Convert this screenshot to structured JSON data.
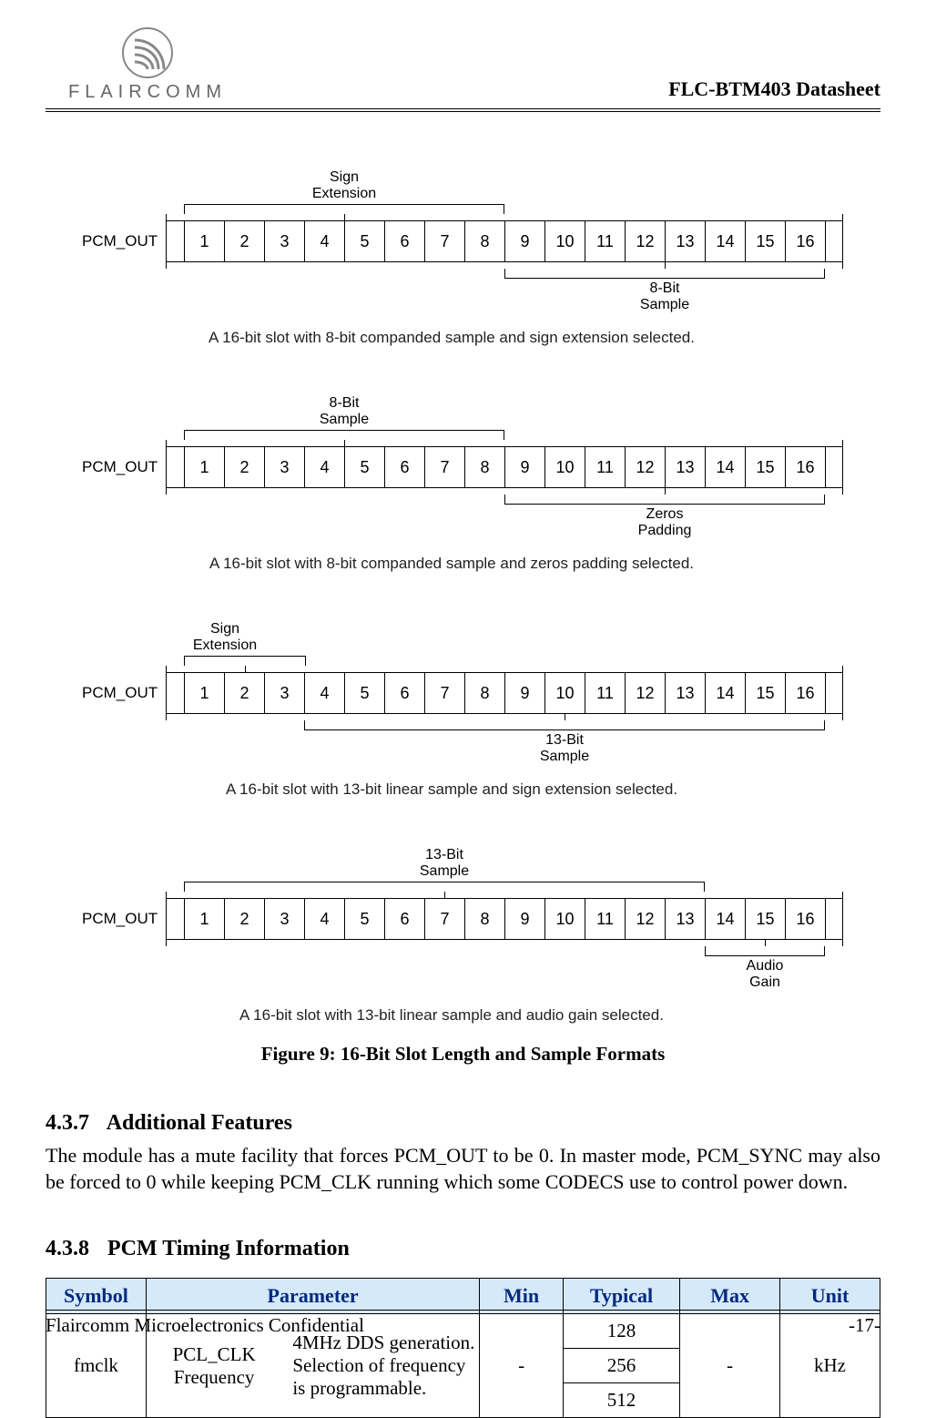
{
  "header": {
    "brand": "FLAIRCOMM",
    "doc_title": "FLC-BTM403 Datasheet"
  },
  "diagrams": {
    "bits": [
      "1",
      "2",
      "3",
      "4",
      "5",
      "6",
      "7",
      "8",
      "9",
      "10",
      "11",
      "12",
      "13",
      "14",
      "15",
      "16"
    ],
    "pcm_label": "PCM_OUT",
    "d1": {
      "top_label": "Sign\nExtension",
      "bot_label": "8-Bit\nSample",
      "caption": "A 16-bit slot with 8-bit companded sample and sign extension selected."
    },
    "d2": {
      "top_label": "8-Bit\nSample",
      "bot_label": "Zeros\nPadding",
      "caption": "A 16-bit slot with 8-bit companded sample and zeros padding selected."
    },
    "d3": {
      "top_label": "Sign\nExtension",
      "bot_label": "13-Bit\nSample",
      "caption": "A 16-bit slot with 13-bit linear sample and sign extension selected."
    },
    "d4": {
      "top_label": "13-Bit\nSample",
      "bot_label": "Audio\nGain",
      "caption": "A 16-bit slot with 13-bit linear sample and audio gain selected."
    }
  },
  "fig_caption": "Figure 9: 16-Bit Slot Length and Sample Formats",
  "sec_437": {
    "num": "4.3.7",
    "title": "Additional Features",
    "text": "The module has a mute facility that forces PCM_OUT to be 0. In master mode, PCM_SYNC may also be forced to 0 while keeping PCM_CLK running which some CODECS use to control power down."
  },
  "sec_438": {
    "num": "4.3.8",
    "title": "PCM Timing Information"
  },
  "table": {
    "headers": {
      "symbol": "Symbol",
      "parameter": "Parameter",
      "min": "Min",
      "typical": "Typical",
      "max": "Max",
      "unit": "Unit"
    },
    "row": {
      "symbol": "fmclk",
      "param_left": "PCL_CLK Frequency",
      "param_right": "4MHz DDS generation. Selection of frequency is programmable.",
      "min": "-",
      "typical": [
        "128",
        "256",
        "512"
      ],
      "max": "-",
      "unit": "kHz"
    }
  },
  "footer": {
    "left": "Flaircomm Microelectronics Confidential",
    "right": "-17-"
  }
}
